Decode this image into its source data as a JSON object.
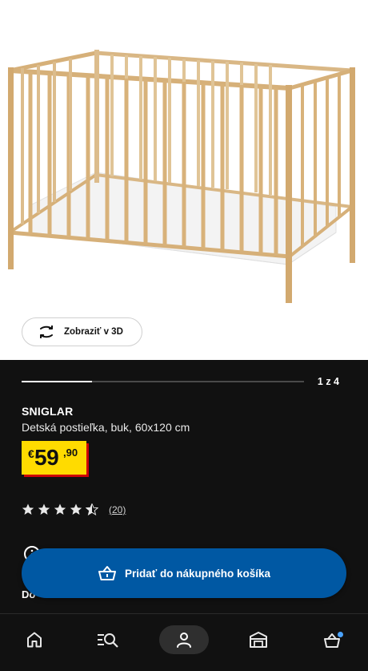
{
  "product": {
    "view_3d_label": "Zobraziť v 3D",
    "gallery": {
      "current": 1,
      "total": 4,
      "pager_text": "1 z 4",
      "progress_fraction": 0.25
    },
    "name": "SNIGLAR",
    "description": "Detská postieľka, buk, 60x120 cm",
    "price": {
      "currency": "€",
      "integer": "59",
      "decimals": ",90"
    },
    "rating": {
      "stars": 4.5,
      "count_text": "(20)"
    },
    "partial_label": "Do"
  },
  "cta": {
    "add_to_cart_label": "Pridať do nákupného košíka"
  },
  "bottom_nav": {
    "items": [
      "home-icon",
      "search-browse-icon",
      "account-icon",
      "store-icon",
      "cart-icon"
    ],
    "active": "account-icon"
  },
  "colors": {
    "accent_blue": "#0058a3",
    "price_yellow": "#ffdb00",
    "price_red": "#cc0008",
    "background_dark": "#111111",
    "notification_dot": "#4aa3ff"
  }
}
